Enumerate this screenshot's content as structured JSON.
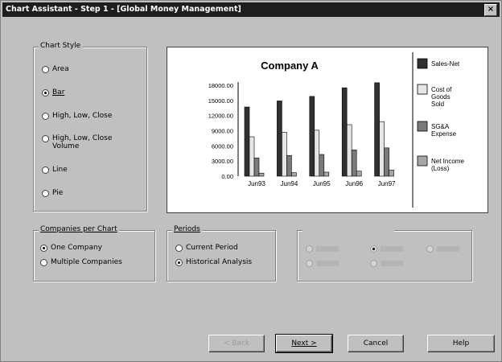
{
  "window": {
    "title": "Chart Assistant - Step 1 - [Global Money Management]",
    "close": "×"
  },
  "chart_style": {
    "label": "Chart Style",
    "options": [
      "Area",
      "Bar",
      "High, Low, Close",
      "High, Low, Close Volume",
      "Line",
      "Pie"
    ],
    "selected": "Bar"
  },
  "companies_per_chart": {
    "label": "Companies per Chart",
    "options": [
      "One Company",
      "Multiple Companies"
    ],
    "selected": "One Company"
  },
  "periods": {
    "label": "Periods",
    "options": [
      "Current Period",
      "Historical Analysis"
    ],
    "selected": "Historical Analysis"
  },
  "disabled_group": {
    "label": "",
    "options": [
      "",
      "",
      "",
      "",
      ""
    ],
    "selected_index": 1
  },
  "buttons": {
    "back": "< Back",
    "next": "Next >",
    "cancel": "Cancel",
    "help": "Help"
  },
  "chart_data": {
    "type": "bar",
    "title": "Company A",
    "categories": [
      "Jun93",
      "Jun94",
      "Jun95",
      "Jun96",
      "Jun97"
    ],
    "ytick_labels": [
      "18000.00",
      "15000.00",
      "12000.00",
      "9000.00",
      "6000.00",
      "3000.00",
      "0.00"
    ],
    "ylim": [
      0,
      18000
    ],
    "series": [
      {
        "name": "Sales-Net",
        "color": "#303030",
        "values": [
          13700,
          14900,
          15800,
          17500,
          18500
        ]
      },
      {
        "name": "Cost of Goods Sold",
        "color": "#e6e6e6",
        "values": [
          7800,
          8700,
          9100,
          10200,
          10800
        ]
      },
      {
        "name": "SG&A Expense",
        "color": "#7a7a7a",
        "values": [
          3600,
          4100,
          4300,
          5200,
          5600
        ]
      },
      {
        "name": "Net Income (Loss)",
        "color": "#a6a6a6",
        "values": [
          600,
          700,
          800,
          1000,
          1200
        ]
      }
    ],
    "legend_position": "right",
    "grid": false
  }
}
